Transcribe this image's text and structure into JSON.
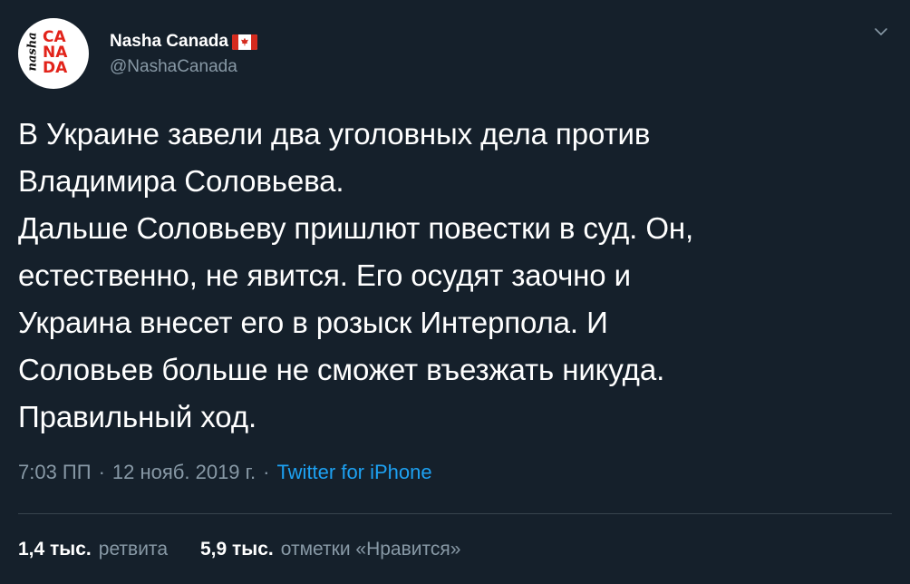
{
  "author": {
    "display_name": "Nasha Canada",
    "handle": "@NashaCanada",
    "avatar": {
      "nasha_text": "nasha",
      "canada_lines": [
        "CA",
        "NA",
        "DA"
      ],
      "colors": {
        "background": "#ffffff",
        "accent": "#e2231a"
      }
    },
    "flag_icon": "canada-flag-emoji"
  },
  "menu_icon": "chevron-down-icon",
  "tweet": {
    "lines": [
      "В Украине завели два уголовных дела против",
      "Владимира Соловьева.",
      "Дальше Соловьеву пришлют повестки в суд. Он,",
      "естественно, не явится. Его осудят заочно и",
      "Украина внесет его в розыск Интерпола. И",
      "Соловьев больше не сможет въезжать никуда.",
      "Правильный ход."
    ]
  },
  "meta": {
    "time": "7:03 ПП",
    "separator": "·",
    "date": "12 нояб. 2019 г.",
    "source": "Twitter for iPhone"
  },
  "stats": {
    "retweets_count": "1,4 тыс.",
    "retweets_label": "ретвита",
    "likes_count": "5,9 тыс.",
    "likes_label": "отметки «Нравится»"
  },
  "colors": {
    "background": "#15202b",
    "text": "#ffffff",
    "muted": "#8899a6",
    "link": "#1da1f2",
    "divider": "#38444d"
  }
}
